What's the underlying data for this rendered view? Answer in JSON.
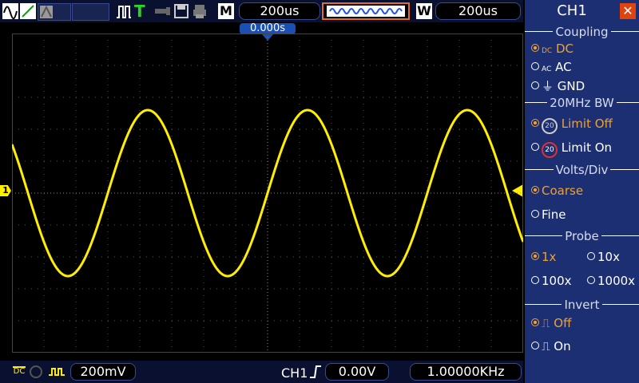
{
  "top": {
    "run_mode_label": "M",
    "timebase": "200us",
    "window_label": "W",
    "window_timebase": "200us",
    "trigger_position": "0.000s"
  },
  "bottom": {
    "volts_div": "200mV",
    "trigger_source": "CH1",
    "trigger_level": "0.00V",
    "frequency": "1.00000KHz"
  },
  "panel": {
    "title": "CH1",
    "coupling": {
      "heading": "Coupling",
      "options": [
        "DC",
        "AC",
        "GND"
      ],
      "selected": "DC"
    },
    "bw": {
      "heading": "20MHz BW",
      "options": [
        "Limit Off",
        "Limit On"
      ],
      "selected": "Limit Off"
    },
    "vdiv": {
      "heading": "Volts/Div",
      "options": [
        "Coarse",
        "Fine"
      ],
      "selected": "Coarse"
    },
    "probe": {
      "heading": "Probe",
      "options": [
        "1x",
        "10x",
        "100x",
        "1000x"
      ],
      "selected": "1x"
    },
    "invert": {
      "heading": "Invert",
      "options": [
        "Off",
        "On"
      ],
      "selected": "Off"
    }
  },
  "colors": {
    "trace": "#ffee00",
    "accent": "#f0a030",
    "panel": "#1c2f73"
  },
  "chart_data": {
    "type": "line",
    "waveform": "sine",
    "cycles_visible": 3.2,
    "amplitude_divisions": 2.6,
    "grid": true,
    "xdivisions": 16,
    "ydivisions": 10
  }
}
